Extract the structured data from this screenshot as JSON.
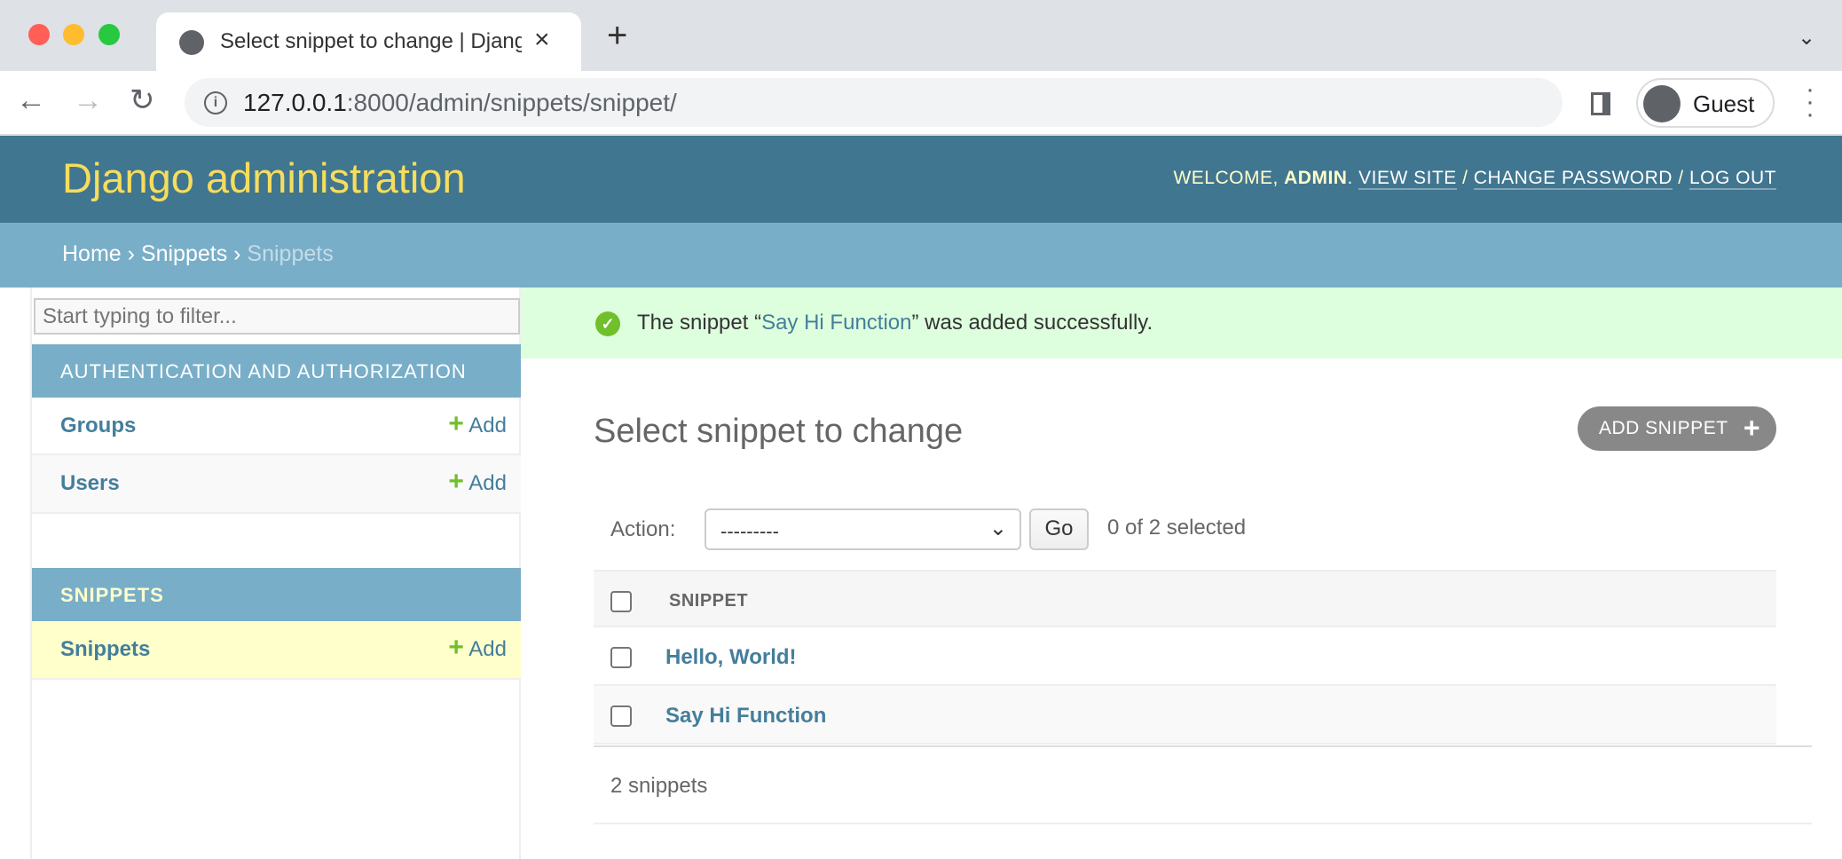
{
  "browser": {
    "tab_title": "Select snippet to change | Django site admin",
    "url_host": "127.0.0.1",
    "url_rest": ":8000/admin/snippets/snippet/",
    "profile_label": "Guest",
    "icons": [
      "globe-icon",
      "close-icon",
      "plus-icon",
      "chevron-down-icon",
      "back-icon",
      "forward-icon",
      "reload-icon",
      "info-icon",
      "side-panel-icon",
      "avatar-icon",
      "more-vert-icon"
    ]
  },
  "header": {
    "branding": "Django administration",
    "welcome": "WELCOME, ",
    "username": "ADMIN",
    "period": ". ",
    "view_site": "VIEW SITE",
    "sep": " / ",
    "change_password": "CHANGE PASSWORD",
    "log_out": "LOG OUT"
  },
  "breadcrumbs": {
    "home": "Home",
    "sep": " › ",
    "app": "Snippets",
    "current": "Snippets"
  },
  "sidebar": {
    "filter_placeholder": "Start typing to filter...",
    "modules": [
      {
        "caption": "AUTHENTICATION AND AUTHORIZATION",
        "models": [
          {
            "name": "Groups",
            "add": "Add"
          },
          {
            "name": "Users",
            "add": "Add"
          }
        ]
      },
      {
        "caption": "SNIPPETS",
        "models": [
          {
            "name": "Snippets",
            "add": "Add"
          }
        ]
      }
    ]
  },
  "message": {
    "prefix": "The snippet “",
    "link": "Say Hi Function",
    "suffix": "” was added successfully."
  },
  "main": {
    "title": "Select snippet to change",
    "add_button": "ADD SNIPPET",
    "action_label": "Action:",
    "action_selected": "---------",
    "go_label": "Go",
    "counter": "0 of 2 selected",
    "column_header": "SNIPPET",
    "rows": [
      "Hello, World!",
      "Say Hi Function"
    ],
    "paginator": "2 snippets"
  },
  "colors": {
    "header": "#417690",
    "breadcrumbs": "#79aec8",
    "branding": "#f5dd5d",
    "link": "#447e9b",
    "success": "#dfd",
    "add_green": "#70bf2b",
    "selected_module": "#ffc"
  }
}
